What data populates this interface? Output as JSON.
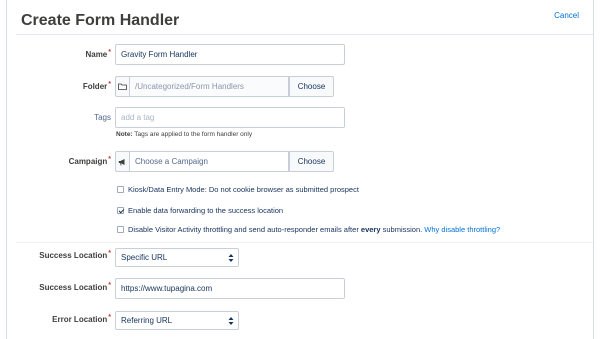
{
  "header": {
    "title": "Create Form Handler",
    "cancel_label": "Cancel"
  },
  "fields": {
    "name": {
      "label": "Name",
      "required": "*",
      "value": "Gravity Form Handler"
    },
    "folder": {
      "label": "Folder",
      "required": "*",
      "value": "/Uncategorized/Form Handlers",
      "choose_label": "Choose",
      "icon": "folder-icon"
    },
    "tags": {
      "label": "Tags",
      "placeholder": "add a tag",
      "note_bold": "Note:",
      "note_text": " Tags are applied to the form handler only"
    },
    "campaign": {
      "label": "Campaign",
      "required": "*",
      "placeholder": "Choose a Campaign",
      "choose_label": "Choose",
      "icon": "megaphone-icon"
    }
  },
  "options": [
    {
      "label": "Kiosk/Data Entry Mode: Do not cookie browser as submitted prospect",
      "checked": false
    },
    {
      "label": "Enable data forwarding to the success location",
      "checked": true
    },
    {
      "label_pre": "Disable Visitor Activity throttling and send auto-responder emails after ",
      "label_bold": "every",
      "label_post": " submission. ",
      "link": "Why disable throttling?",
      "checked": false
    }
  ],
  "success_type": {
    "label": "Success Location",
    "required": "*",
    "value": "Specific URL"
  },
  "success_url": {
    "label": "Success Location",
    "required": "*",
    "value": "https://www.tupagina.com"
  },
  "error_location": {
    "label": "Error Location",
    "required": "*",
    "value": "Referring URL"
  },
  "colors": {
    "accent": "#0070d2",
    "required": "#c23934",
    "text": "#16325c",
    "border": "#c9cfd8"
  }
}
